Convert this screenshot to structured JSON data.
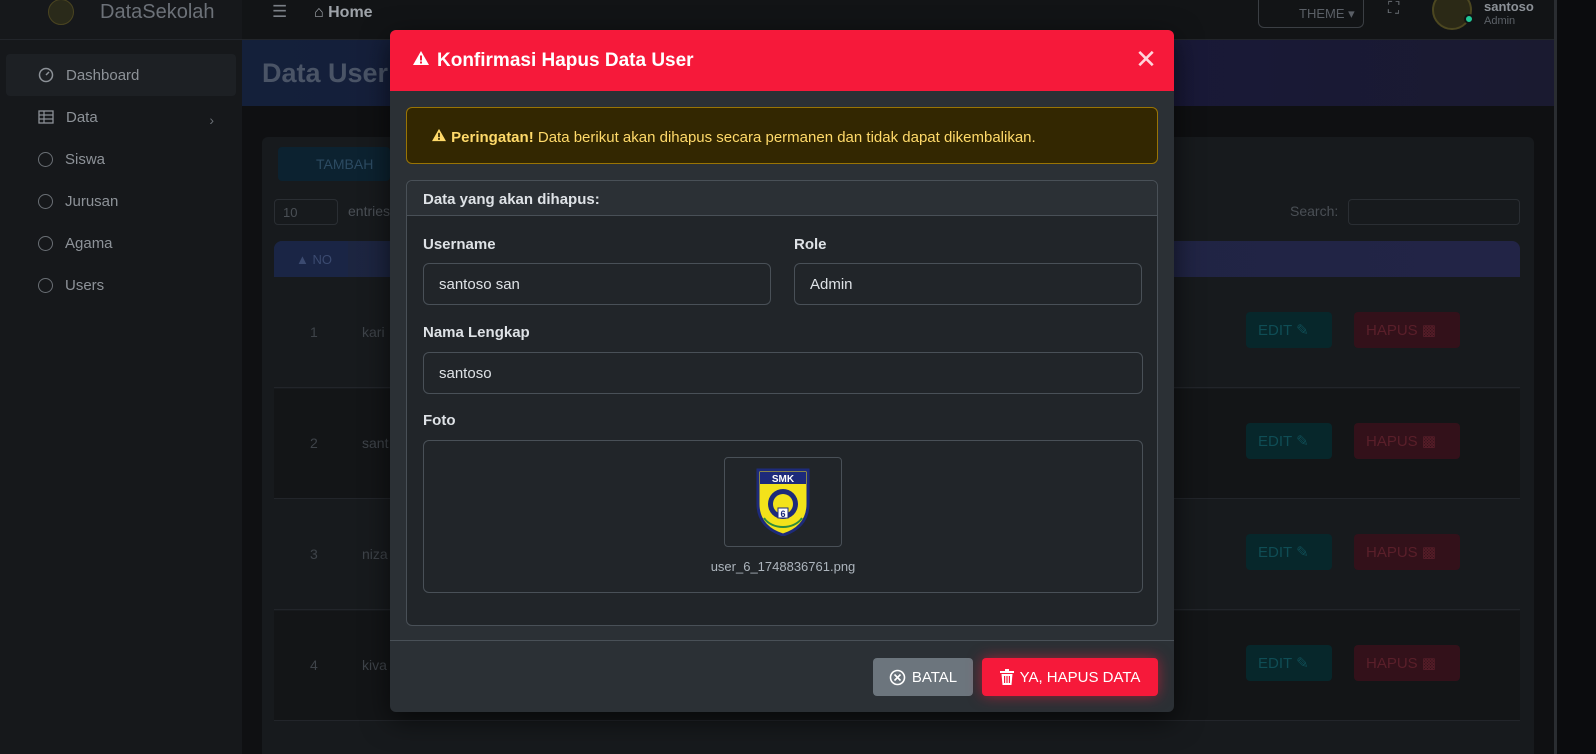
{
  "app": {
    "brand": "DataSekolah"
  },
  "sidebar": {
    "items": [
      {
        "label": "Dashboard",
        "icon": "gauge-icon"
      },
      {
        "label": "Data",
        "icon": "table-icon"
      },
      {
        "label": "Siswa",
        "icon": "circle-icon"
      },
      {
        "label": "Jurusan",
        "icon": "circle-icon"
      },
      {
        "label": "Agama",
        "icon": "circle-icon"
      },
      {
        "label": "Users",
        "icon": "circle-icon"
      }
    ]
  },
  "topbar": {
    "home_label": "Home",
    "theme_label": "THEME",
    "user_name": "santoso",
    "user_role": "Admin"
  },
  "page": {
    "title": "Data User",
    "add_button": "TAMBAH",
    "entries_value": "10",
    "entries_label": "entries",
    "search_label": "Search:",
    "col_no": "NO",
    "rows": [
      {
        "no": "1",
        "name": "kari"
      },
      {
        "no": "2",
        "name": "sant"
      },
      {
        "no": "3",
        "name": "niza"
      },
      {
        "no": "4",
        "name": "kiva"
      }
    ],
    "edit_label": "EDIT",
    "hapus_label": "HAPUS"
  },
  "modal": {
    "title": "Konfirmasi Hapus Data User",
    "alert_strong": "Peringatan!",
    "alert_text": "Data berikut akan dihapus secara permanen dan tidak dapat dikembalikan.",
    "panel_title": "Data yang akan dihapus:",
    "username_label": "Username",
    "username_value": "santoso san",
    "role_label": "Role",
    "role_value": "Admin",
    "fullname_label": "Nama Lengkap",
    "fullname_value": "santoso",
    "photo_label": "Foto",
    "photo_filename": "user_6_1748836761.png",
    "logo_text": "SMK",
    "logo_number": "6",
    "cancel_label": "BATAL",
    "confirm_label": "YA, HAPUS DATA"
  },
  "colors": {
    "danger": "#f6193a",
    "warning_text": "#ffda6a",
    "secondary": "#6c757d"
  }
}
